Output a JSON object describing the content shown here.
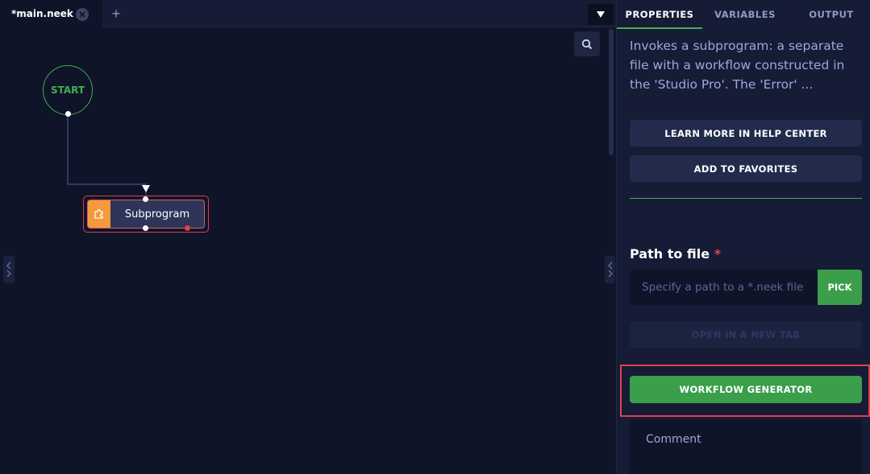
{
  "editor": {
    "tab_label": "*main.neek",
    "add_tab": "+"
  },
  "canvas": {
    "start_label": "START",
    "node_label": "Subprogram"
  },
  "panel": {
    "tabs": [
      {
        "label": "PROPERTIES",
        "active": true
      },
      {
        "label": "VARIABLES",
        "active": false
      },
      {
        "label": "OUTPUT",
        "active": false
      }
    ],
    "description": "Invokes a subprogram: a separate file with a workflow constructed in the 'Studio Pro'. The 'Error' ...",
    "learn_more": "LEARN MORE IN HELP CENTER",
    "favorites": "ADD TO FAVORITES",
    "path_label": "Path to file",
    "required_mark": "*",
    "path_placeholder": "Specify a path to a *.neek file",
    "pick": "PICK",
    "open_new_tab": "OPEN IN A NEW TAB",
    "workflow_generator": "WORKFLOW GENERATOR",
    "comment_placeholder": "Comment"
  },
  "colors": {
    "accent_green": "#3fae54",
    "highlight_red": "#e0414f",
    "node_icon_orange": "#f5993d"
  }
}
